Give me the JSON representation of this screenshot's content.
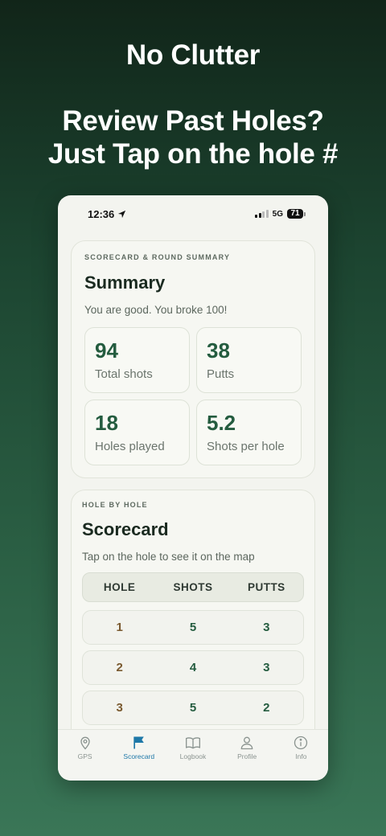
{
  "promo": {
    "line1": "No Clutter",
    "line2": "Review Past Holes?",
    "line3": "Just Tap on the hole #"
  },
  "status_bar": {
    "time": "12:36",
    "network": "5G",
    "battery": "71"
  },
  "summary": {
    "eyebrow": "SCORECARD & ROUND SUMMARY",
    "title": "Summary",
    "subtitle": "You are good. You broke 100!",
    "stats": [
      {
        "value": "94",
        "label": "Total shots"
      },
      {
        "value": "38",
        "label": "Putts"
      },
      {
        "value": "18",
        "label": "Holes played"
      },
      {
        "value": "5.2",
        "label": "Shots per hole"
      }
    ]
  },
  "scorecard": {
    "eyebrow": "HOLE BY HOLE",
    "title": "Scorecard",
    "subtitle": "Tap on the hole to see it on the map",
    "columns": [
      "HOLE",
      "SHOTS",
      "PUTTS"
    ],
    "rows": [
      {
        "hole": "1",
        "shots": "5",
        "putts": "3"
      },
      {
        "hole": "2",
        "shots": "4",
        "putts": "3"
      },
      {
        "hole": "3",
        "shots": "5",
        "putts": "2"
      }
    ]
  },
  "tabbar": {
    "items": [
      {
        "label": "GPS",
        "icon": "map-pin-icon"
      },
      {
        "label": "Scorecard",
        "icon": "flag-icon",
        "active": true
      },
      {
        "label": "Logbook",
        "icon": "book-icon"
      },
      {
        "label": "Profile",
        "icon": "person-icon"
      },
      {
        "label": "Info",
        "icon": "info-icon"
      }
    ]
  },
  "colors": {
    "accent": "#245c3f",
    "active_tab": "#1e78a8",
    "hole_number": "#7a5a30"
  }
}
